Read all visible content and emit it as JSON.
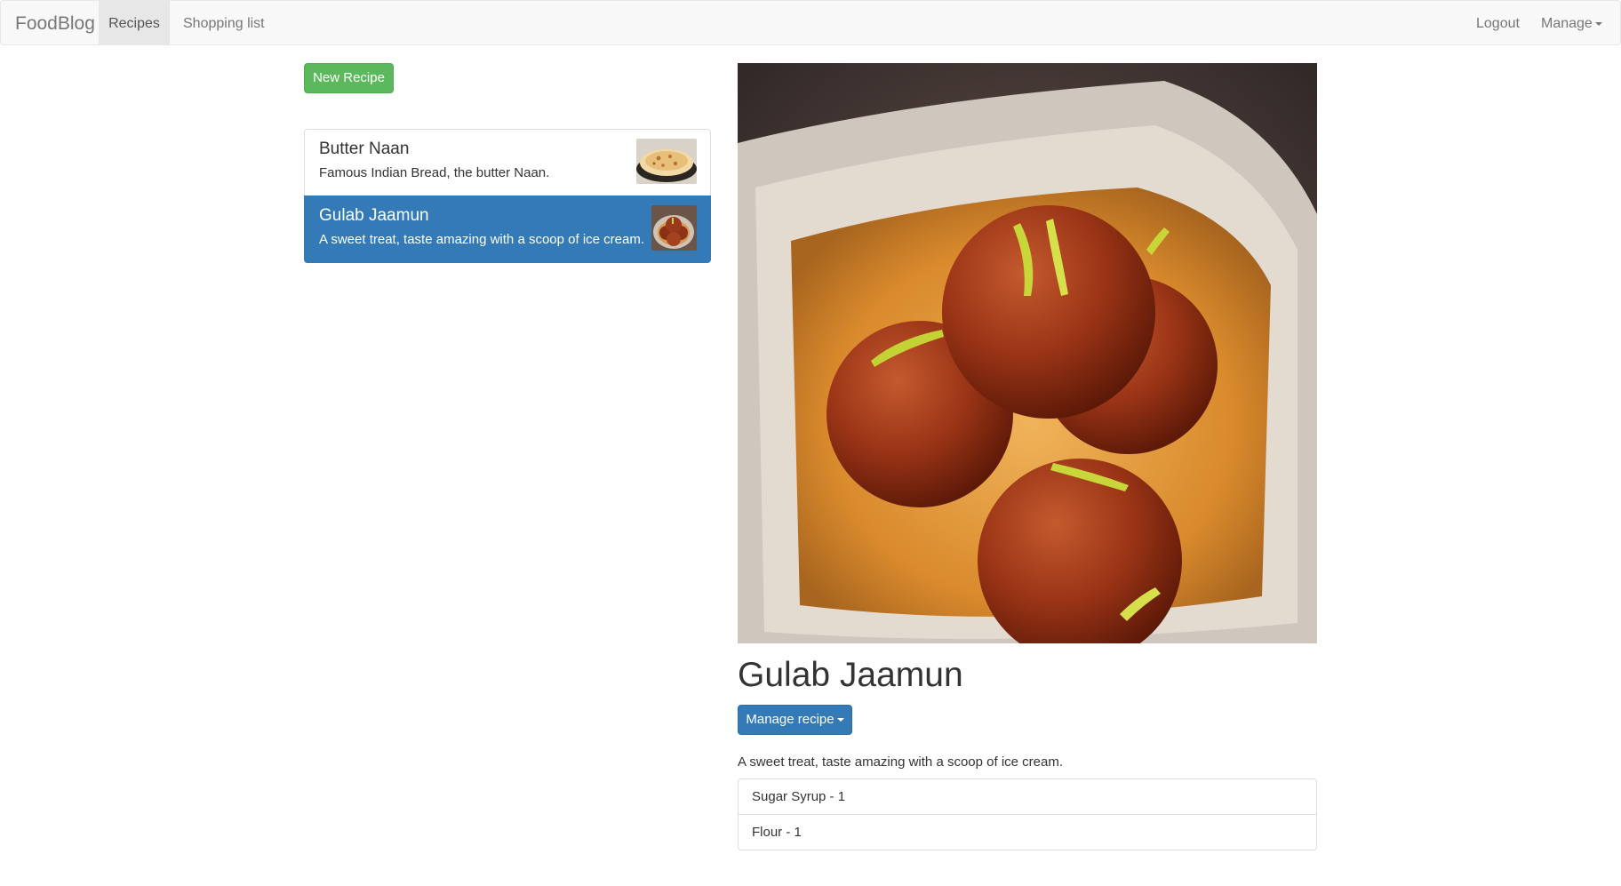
{
  "navbar": {
    "brand": "FoodBlog",
    "links": [
      "Recipes",
      "Shopping list"
    ],
    "right": {
      "logout": "Logout",
      "manage": "Manage"
    },
    "active": "Recipes"
  },
  "sidebar": {
    "new_recipe_label": "New Recipe",
    "recipes": [
      {
        "name": "Butter Naan",
        "description": "Famous Indian Bread, the butter Naan.",
        "thumb_icon": "naan-photo",
        "selected": false
      },
      {
        "name": "Gulab Jaamun",
        "description": "A sweet treat, taste amazing with a scoop of ice cream.",
        "thumb_icon": "gulab-jaamun-photo",
        "selected": true
      }
    ]
  },
  "detail": {
    "image_icon": "gulab-jaamun-photo",
    "title": "Gulab Jaamun",
    "manage_label": "Manage recipe",
    "description": "A sweet treat, taste amazing with a scoop of ice cream.",
    "ingredients": [
      "Sugar Syrup - 1",
      "Flour - 1"
    ]
  },
  "colors": {
    "success": "#5cb85c",
    "primary": "#337ab7",
    "navbar_bg": "#f8f8f8"
  }
}
